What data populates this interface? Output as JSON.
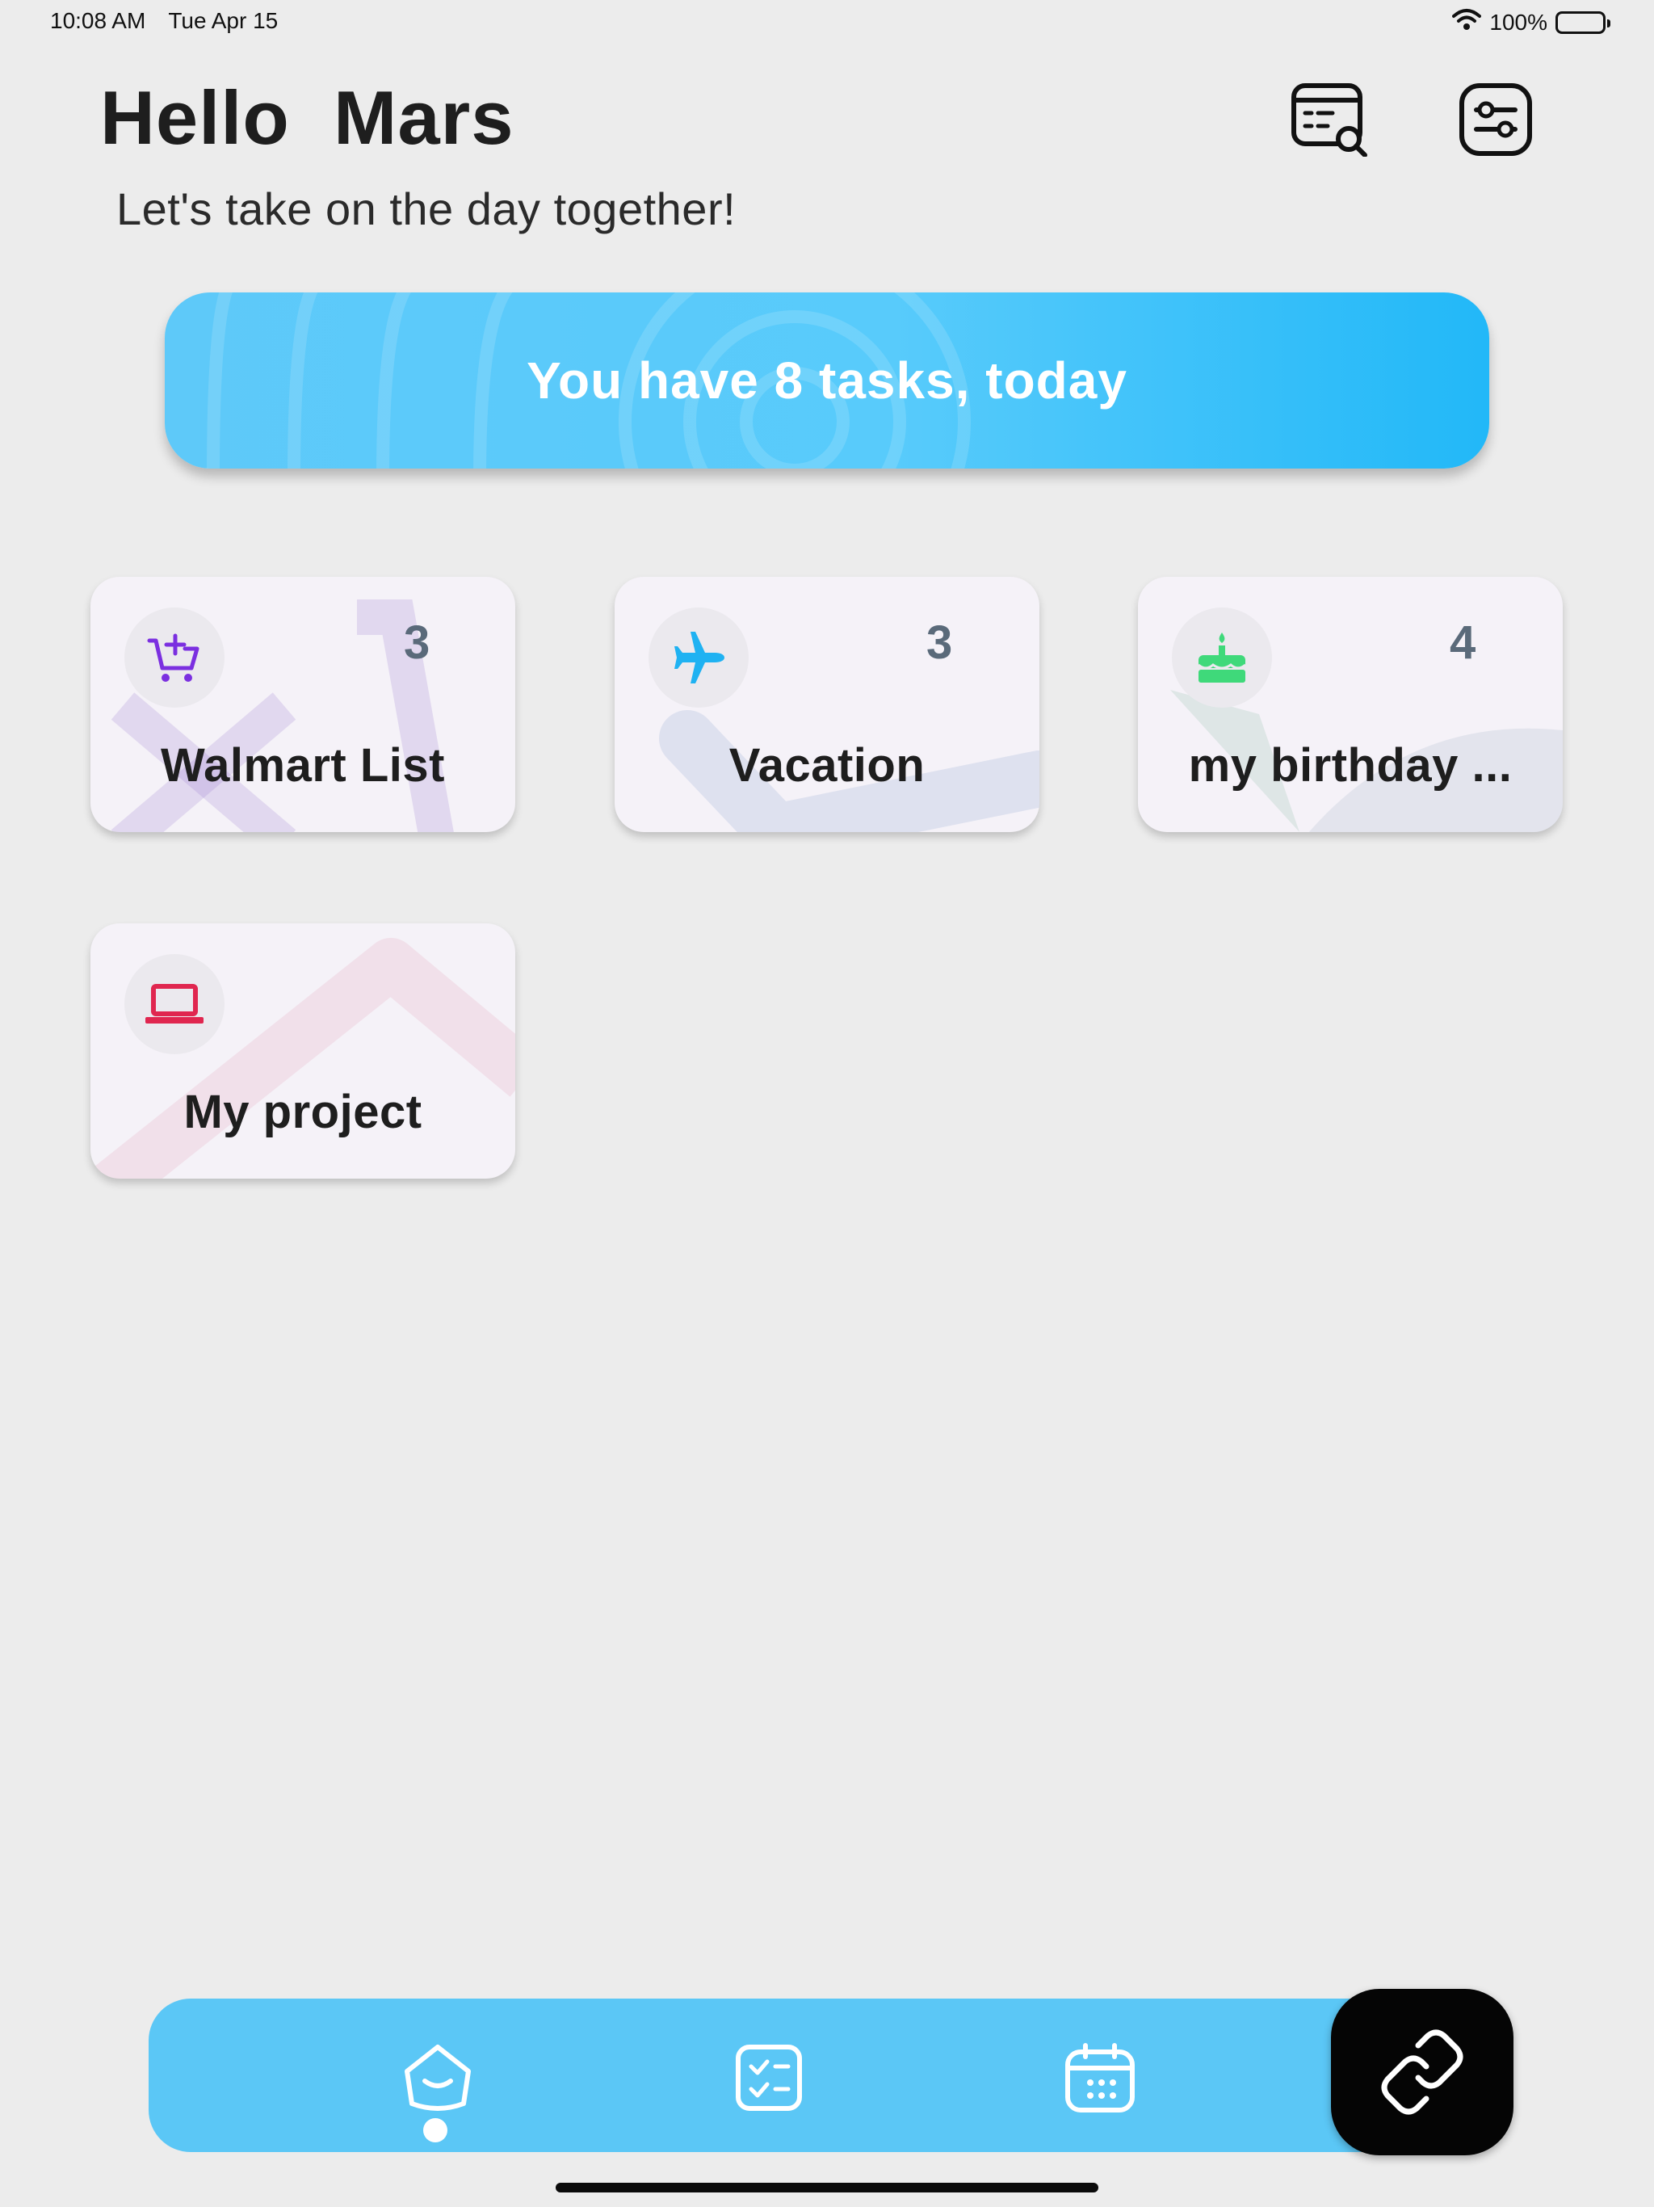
{
  "status_bar": {
    "time": "10:08 AM",
    "date": "Tue Apr 15",
    "battery": "100%"
  },
  "header": {
    "greeting": "Hello  Mars",
    "subtitle": "Let's take on the day together!",
    "search_icon": "calendar-search-icon",
    "settings_icon": "settings-sliders-icon"
  },
  "banner": {
    "text": "You have 8 tasks, today"
  },
  "lists": [
    {
      "name": "Walmart List",
      "count": "3",
      "icon": "cart-plus-icon",
      "color": "#7b2fe0"
    },
    {
      "name": "Vacation",
      "count": "3",
      "icon": "airplane-icon",
      "color": "#1fb2f2"
    },
    {
      "name": "my birthday ...",
      "count": "4",
      "icon": "cake-icon",
      "color": "#3fd97a"
    },
    {
      "name": "My project",
      "count": "",
      "icon": "laptop-icon",
      "color": "#e0264f"
    }
  ],
  "nav": {
    "items": [
      "home-icon",
      "tasks-icon",
      "calendar-icon"
    ],
    "active": "home-icon",
    "fab_icon": "link-icon"
  },
  "colors": {
    "accent": "#5bc7f6",
    "background": "#ececec",
    "fab": "#050505"
  }
}
